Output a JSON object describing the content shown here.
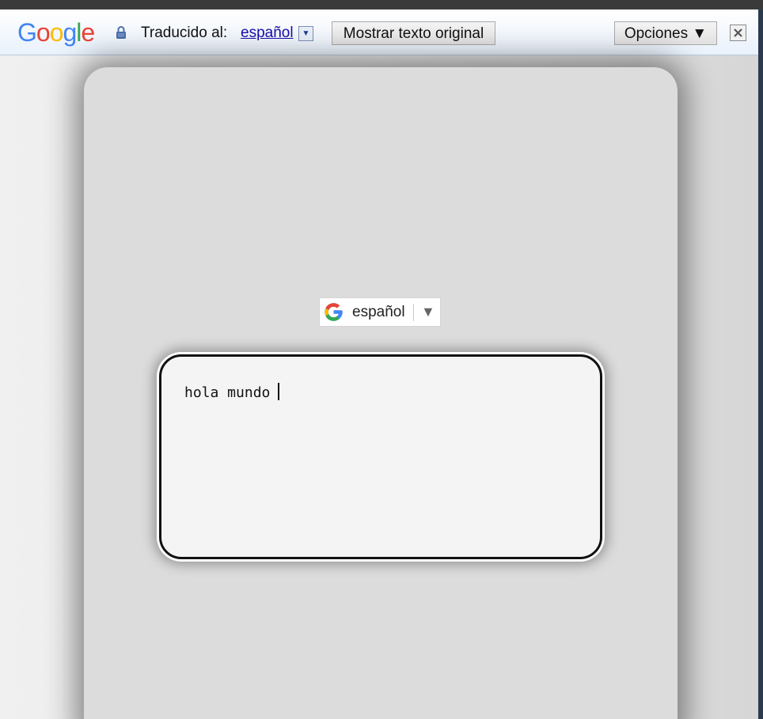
{
  "translate_bar": {
    "logo_letters": [
      "G",
      "o",
      "o",
      "g",
      "l",
      "e"
    ],
    "logo_colors": [
      "#4285f4",
      "#ea4335",
      "#fbbc05",
      "#4285f4",
      "#34a853",
      "#ea4335"
    ],
    "label": "Traducido al:",
    "language_link": "español",
    "show_original_button": "Mostrar texto original",
    "options_button": "Opciones ▼"
  },
  "language_widget": {
    "label": "español",
    "arrow": "▼"
  },
  "textbox": {
    "text": "hola mundo"
  },
  "colors": {
    "panel": "#dcdcdc",
    "textbox_bg": "#f4f4f4",
    "link": "#1a0dab"
  }
}
